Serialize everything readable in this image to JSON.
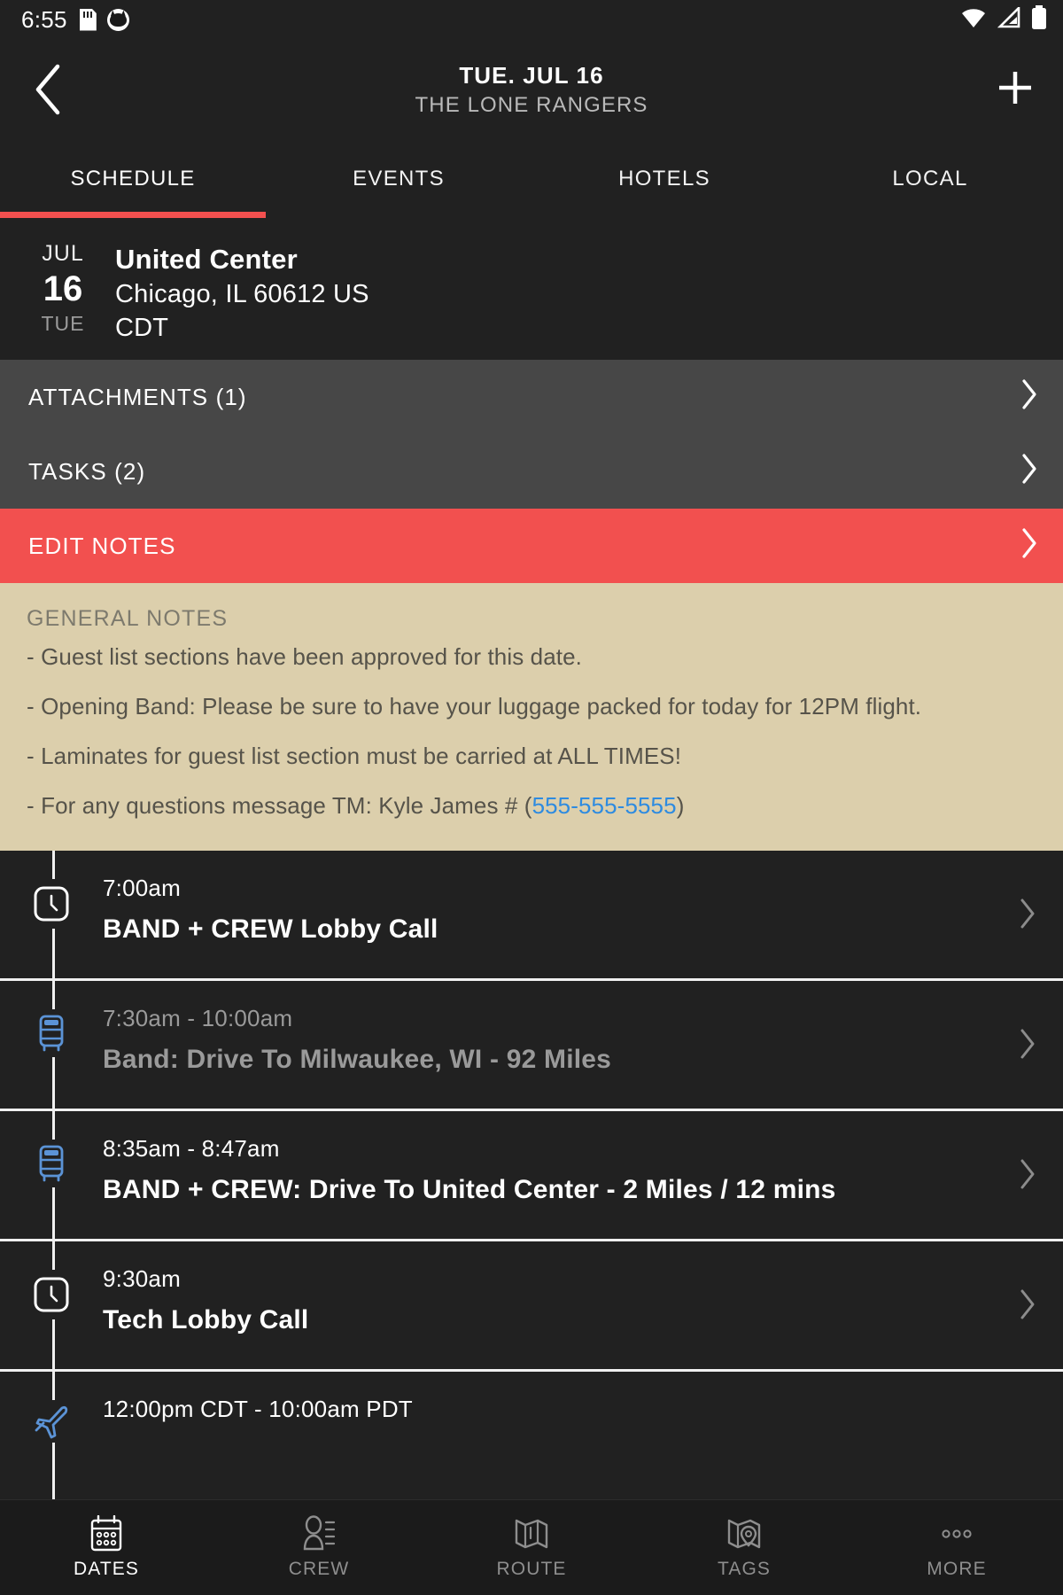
{
  "status_bar": {
    "time": "6:55",
    "left_icons": [
      "sd-card-icon",
      "cat-app-icon"
    ],
    "right_icons": [
      "wifi-icon",
      "cell-signal-icon",
      "battery-icon"
    ]
  },
  "header": {
    "back_icon": "chevron-left-icon",
    "date_title": "TUE. JUL 16",
    "band_subtitle": "THE LONE RANGERS",
    "add_icon": "plus-icon"
  },
  "tabs": [
    {
      "label": "SCHEDULE",
      "active": true
    },
    {
      "label": "EVENTS",
      "active": false
    },
    {
      "label": "HOTELS",
      "active": false
    },
    {
      "label": "LOCAL",
      "active": false
    }
  ],
  "venue": {
    "month": "JUL",
    "day": "16",
    "weekday": "TUE",
    "name": "United Center",
    "address": "Chicago, IL 60612 US",
    "timezone": "CDT"
  },
  "action_rows": [
    {
      "label": "ATTACHMENTS (1)",
      "style": "gray"
    },
    {
      "label": "TASKS (2)",
      "style": "gray"
    },
    {
      "label": "EDIT NOTES",
      "style": "red"
    }
  ],
  "notes": {
    "title": "GENERAL NOTES",
    "lines": [
      "- Guest list sections have been approved for this date.",
      "- Opening Band: Please be sure to have your luggage packed for today for 12PM flight.",
      "- Laminates for guest list section must be carried at ALL TIMES!"
    ],
    "contact_prefix": "-  For any questions message TM: Kyle James # (",
    "contact_phone": "555-555-5555",
    "contact_suffix": ")"
  },
  "schedule": [
    {
      "icon": "clock-icon",
      "time": "7:00am",
      "title": "BAND + CREW Lobby Call",
      "state": "bright"
    },
    {
      "icon": "bus-icon",
      "time": "7:30am - 10:00am",
      "title": "Band: Drive To Milwaukee, WI - 92 Miles",
      "state": "dim"
    },
    {
      "icon": "bus-icon",
      "time": "8:35am - 8:47am",
      "title": "BAND + CREW: Drive To United Center - 2 Miles / 12 mins",
      "state": "bright"
    },
    {
      "icon": "clock-icon",
      "time": "9:30am",
      "title": "Tech Lobby Call",
      "state": "bright"
    },
    {
      "icon": "plane-icon",
      "time": "12:00pm CDT - 10:00am PDT",
      "title": "",
      "state": "bright"
    }
  ],
  "bottom_nav": [
    {
      "label": "DATES",
      "icon": "calendar-icon",
      "active": true
    },
    {
      "label": "CREW",
      "icon": "person-list-icon",
      "active": false
    },
    {
      "label": "ROUTE",
      "icon": "map-icon",
      "active": false
    },
    {
      "label": "TAGS",
      "icon": "map-pin-icon",
      "active": false
    },
    {
      "label": "MORE",
      "icon": "ellipsis-icon",
      "active": false
    }
  ],
  "colors": {
    "background": "#212121",
    "accent_red": "#F2504F",
    "row_gray": "#474747",
    "notes_bg": "#DCCFAC",
    "link_blue": "#2E8BE0",
    "transport_blue": "#5B93D6"
  }
}
